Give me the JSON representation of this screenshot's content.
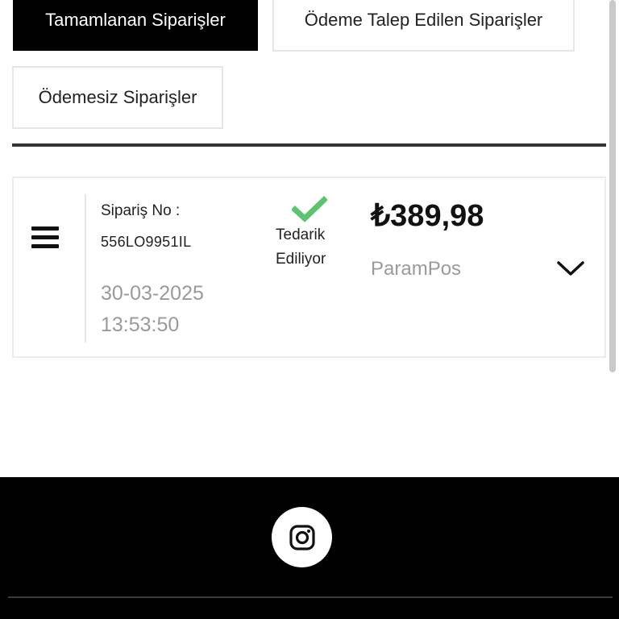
{
  "tabs": [
    {
      "label": "Tamamlanan Siparişler",
      "active": true
    },
    {
      "label": "Ödeme Talep Edilen Siparişler",
      "active": false
    },
    {
      "label": "Ödemesiz Siparişler",
      "active": false
    }
  ],
  "order": {
    "number_label": "Sipariş No :",
    "number": "556LO9951IL",
    "date": "30-03-2025",
    "time": "13:53:50",
    "status_line1": "Tedarik",
    "status_line2": "Ediliyor",
    "price": "₺389,98",
    "payment_method": "ParamPos"
  },
  "icons": {
    "menu": "hamburger-icon",
    "status": "checkmark-icon",
    "expand": "chevron-down-icon",
    "social": "instagram-icon"
  },
  "colors": {
    "active_tab_bg": "#000000",
    "status_check": "#5cc36f",
    "muted_text": "#9a9a9a",
    "footer_bg": "#000000"
  }
}
